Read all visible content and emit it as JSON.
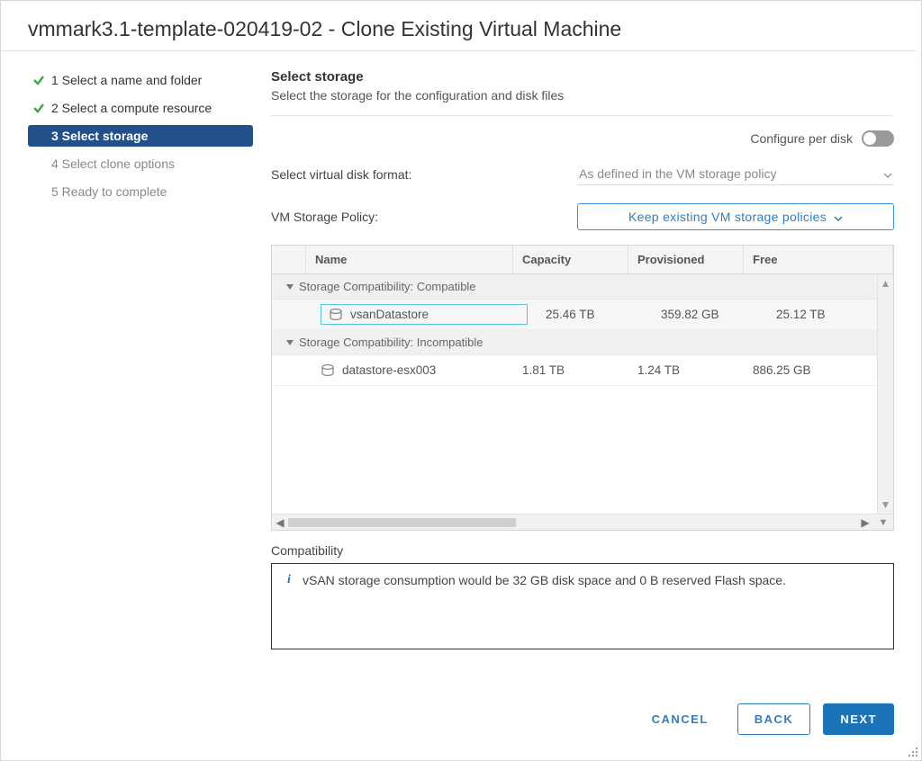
{
  "dialog": {
    "title": "vmmark3.1-template-020419-02 - Clone Existing Virtual Machine"
  },
  "wizard": {
    "steps": [
      {
        "label": "1 Select a name and folder",
        "state": "done"
      },
      {
        "label": "2 Select a compute resource",
        "state": "done"
      },
      {
        "label": "3 Select storage",
        "state": "current"
      },
      {
        "label": "4 Select clone options",
        "state": "pending"
      },
      {
        "label": "5 Ready to complete",
        "state": "pending"
      }
    ]
  },
  "main": {
    "title": "Select storage",
    "subtitle": "Select the storage for the configuration and disk files",
    "configure_per_disk_label": "Configure per disk",
    "disk_format_label": "Select virtual disk format:",
    "disk_format_value": "As defined in the VM storage policy",
    "storage_policy_label": "VM Storage Policy:",
    "storage_policy_value": "Keep existing VM storage policies"
  },
  "table": {
    "headers": {
      "name": "Name",
      "capacity": "Capacity",
      "provisioned": "Provisioned",
      "free": "Free"
    },
    "groups": [
      {
        "label": "Storage Compatibility: Compatible",
        "rows": [
          {
            "name": "vsanDatastore",
            "capacity": "25.46 TB",
            "provisioned": "359.82 GB",
            "free": "25.12 TB",
            "selected": true
          }
        ]
      },
      {
        "label": "Storage Compatibility: Incompatible",
        "rows": [
          {
            "name": "datastore-esx003",
            "capacity": "1.81 TB",
            "provisioned": "1.24 TB",
            "free": "886.25 GB",
            "selected": false
          }
        ]
      }
    ]
  },
  "compat": {
    "label": "Compatibility",
    "message": "vSAN storage consumption would be 32 GB disk space and 0 B reserved Flash space."
  },
  "footer": {
    "cancel": "CANCEL",
    "back": "BACK",
    "next": "NEXT"
  }
}
